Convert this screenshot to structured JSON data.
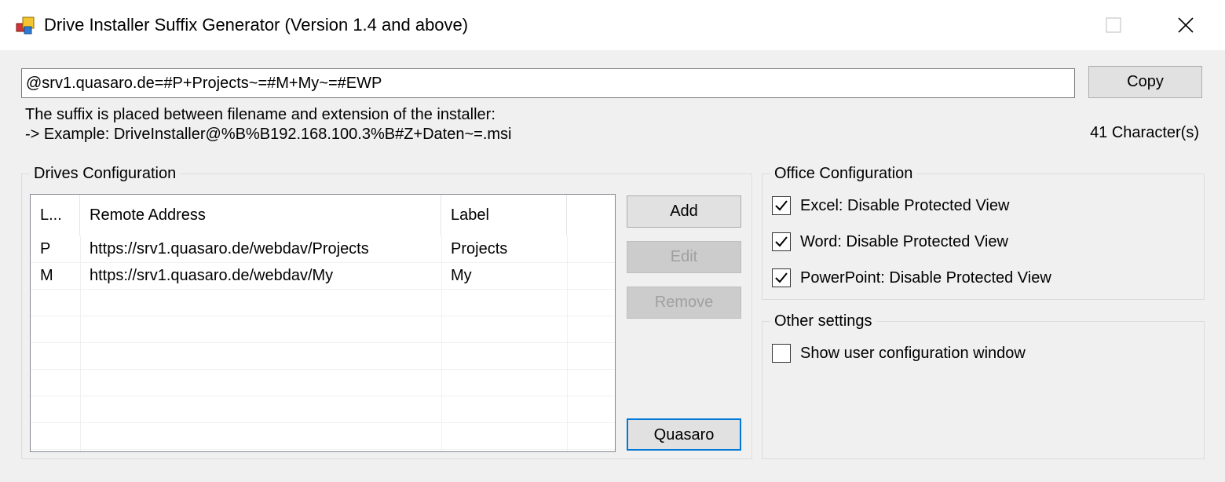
{
  "window": {
    "title": "Drive Installer Suffix Generator (Version 1.4 and above)",
    "icon": "app-icon",
    "controls": [
      "minimize-icon",
      "maximize-icon",
      "close-icon"
    ]
  },
  "suffix": {
    "value": "@srv1.quasaro.de=#P+Projects~=#M+My~=#EWP",
    "copy_label": "Copy",
    "description_line1": "The suffix is placed between filename and extension of the installer:",
    "description_line2": "-> Example: DriveInstaller@%B%B192.168.100.3%B#Z+Daten~=.msi",
    "char_count": "41 Character(s)"
  },
  "drives": {
    "group_title": "Drives Configuration",
    "columns": [
      "L...",
      "Remote Address",
      "Label"
    ],
    "rows": [
      {
        "letter": "P",
        "address": "https://srv1.quasaro.de/webdav/Projects",
        "label": "Projects"
      },
      {
        "letter": "M",
        "address": "https://srv1.quasaro.de/webdav/My",
        "label": "My"
      }
    ],
    "buttons": {
      "add": "Add",
      "edit": "Edit",
      "remove": "Remove",
      "quasaro": "Quasaro"
    }
  },
  "office": {
    "group_title": "Office Configuration",
    "options": [
      {
        "label": "Excel: Disable Protected View",
        "checked": true
      },
      {
        "label": "Word: Disable Protected View",
        "checked": true
      },
      {
        "label": "PowerPoint: Disable Protected View",
        "checked": true
      }
    ]
  },
  "other": {
    "group_title": "Other settings",
    "options": [
      {
        "label": "Show user configuration window",
        "checked": false
      }
    ]
  },
  "colors": {
    "focus_border": "#0078d7",
    "window_bg": "#f0f0f0",
    "disabled_text": "#a0a0a0"
  }
}
